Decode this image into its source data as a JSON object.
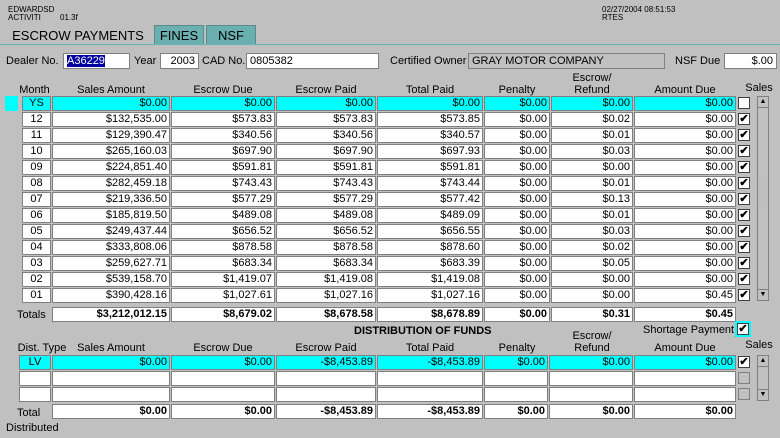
{
  "header": {
    "user": "EDWARDSD",
    "module": "ACTIVITI",
    "module_code": "01.3f",
    "datetime": "02/27/2004 08:51:53",
    "env": "RTES"
  },
  "tabs": [
    {
      "label": "ESCROW PAYMENTS",
      "active": true
    },
    {
      "label": "FINES",
      "active": false
    },
    {
      "label": "NSF",
      "active": false
    }
  ],
  "form": {
    "dealer_label": "Dealer No.",
    "dealer_value": "A36229",
    "year_label": "Year",
    "year_value": "2003",
    "cad_label": "CAD No.",
    "cad_value": "0805382",
    "owner_label": "Certified Owner",
    "owner_value": "GRAY MOTOR COMPANY",
    "nsf_label": "NSF Due",
    "nsf_value": "$.00"
  },
  "escrow_table": {
    "headers": {
      "month": "Month",
      "sales_amount": "Sales Amount",
      "escrow_due": "Escrow Due",
      "escrow_paid": "Escrow Paid",
      "total_paid": "Total Paid",
      "penalty": "Penalty",
      "escrow_refund_1": "Escrow/",
      "escrow_refund_2": "Refund",
      "amount_due": "Amount Due",
      "sales": "Sales"
    },
    "rows": [
      {
        "month": "YS",
        "sales": "$0.00",
        "due": "$0.00",
        "paid": "$0.00",
        "total": "$0.00",
        "penalty": "$0.00",
        "refund": "$0.00",
        "amount": "$0.00",
        "checked": "",
        "highlight": true
      },
      {
        "month": "12",
        "sales": "$132,535.00",
        "due": "$573.83",
        "paid": "$573.83",
        "total": "$573.85",
        "penalty": "$0.00",
        "refund": "$0.02",
        "amount": "$0.00",
        "checked": "✔",
        "highlight": false
      },
      {
        "month": "11",
        "sales": "$129,390.47",
        "due": "$340.56",
        "paid": "$340.56",
        "total": "$340.57",
        "penalty": "$0.00",
        "refund": "$0.01",
        "amount": "$0.00",
        "checked": "✔",
        "highlight": false
      },
      {
        "month": "10",
        "sales": "$265,160.03",
        "due": "$697.90",
        "paid": "$697.90",
        "total": "$697.93",
        "penalty": "$0.00",
        "refund": "$0.03",
        "amount": "$0.00",
        "checked": "✔",
        "highlight": false
      },
      {
        "month": "09",
        "sales": "$224,851.40",
        "due": "$591.81",
        "paid": "$591.81",
        "total": "$591.81",
        "penalty": "$0.00",
        "refund": "$0.00",
        "amount": "$0.00",
        "checked": "✔",
        "highlight": false
      },
      {
        "month": "08",
        "sales": "$282,459.18",
        "due": "$743.43",
        "paid": "$743.43",
        "total": "$743.44",
        "penalty": "$0.00",
        "refund": "$0.01",
        "amount": "$0.00",
        "checked": "✔",
        "highlight": false
      },
      {
        "month": "07",
        "sales": "$219,336.50",
        "due": "$577.29",
        "paid": "$577.29",
        "total": "$577.42",
        "penalty": "$0.00",
        "refund": "$0.13",
        "amount": "$0.00",
        "checked": "✔",
        "highlight": false
      },
      {
        "month": "06",
        "sales": "$185,819.50",
        "due": "$489.08",
        "paid": "$489.08",
        "total": "$489.09",
        "penalty": "$0.00",
        "refund": "$0.01",
        "amount": "$0.00",
        "checked": "✔",
        "highlight": false
      },
      {
        "month": "05",
        "sales": "$249,437.44",
        "due": "$656.52",
        "paid": "$656.52",
        "total": "$656.55",
        "penalty": "$0.00",
        "refund": "$0.03",
        "amount": "$0.00",
        "checked": "✔",
        "highlight": false
      },
      {
        "month": "04",
        "sales": "$333,808.06",
        "due": "$878.58",
        "paid": "$878.58",
        "total": "$878.60",
        "penalty": "$0.00",
        "refund": "$0.02",
        "amount": "$0.00",
        "checked": "✔",
        "highlight": false
      },
      {
        "month": "03",
        "sales": "$259,627.71",
        "due": "$683.34",
        "paid": "$683.34",
        "total": "$683.39",
        "penalty": "$0.00",
        "refund": "$0.05",
        "amount": "$0.00",
        "checked": "✔",
        "highlight": false
      },
      {
        "month": "02",
        "sales": "$539,158.70",
        "due": "$1,419.07",
        "paid": "$1,419.08",
        "total": "$1,419.08",
        "penalty": "$0.00",
        "refund": "$0.00",
        "amount": "$0.00",
        "checked": "✔",
        "highlight": false
      },
      {
        "month": "01",
        "sales": "$390,428.16",
        "due": "$1,027.61",
        "paid": "$1,027.16",
        "total": "$1,027.16",
        "penalty": "$0.00",
        "refund": "$0.00",
        "amount": "$0.45",
        "checked": "✔",
        "highlight": false
      }
    ],
    "totals": {
      "label": "Totals",
      "sales": "$3,212,012.15",
      "due": "$8,679.02",
      "paid": "$8,678.58",
      "total": "$8,678.89",
      "penalty": "$0.00",
      "refund": "$0.31",
      "amount": "$0.45"
    }
  },
  "distribution": {
    "title": "DISTRIBUTION OF FUNDS",
    "shortage_label": "Shortage Payment",
    "shortage_checked": "✔",
    "headers": {
      "dist_type": "Dist. Type",
      "sales_amount": "Sales Amount",
      "escrow_due": "Escrow Due",
      "escrow_paid": "Escrow Paid",
      "total_paid": "Total Paid",
      "penalty": "Penalty",
      "escrow_refund_1": "Escrow/",
      "escrow_refund_2": "Refund",
      "amount_due": "Amount Due",
      "sales": "Sales"
    },
    "rows": [
      {
        "type": "LV",
        "sales": "$0.00",
        "due": "$0.00",
        "paid": "-$8,453.89",
        "total": "-$8,453.89",
        "penalty": "$0.00",
        "refund": "$0.00",
        "amount": "$0.00",
        "checked": "✔",
        "highlight": true
      },
      {
        "type": "",
        "sales": "",
        "due": "",
        "paid": "",
        "total": "",
        "penalty": "",
        "refund": "",
        "amount": "",
        "checked": "",
        "highlight": false
      },
      {
        "type": "",
        "sales": "",
        "due": "",
        "paid": "",
        "total": "",
        "penalty": "",
        "refund": "",
        "amount": "",
        "checked": "",
        "highlight": false
      }
    ],
    "totals": {
      "label": "Total",
      "sales": "$0.00",
      "due": "$0.00",
      "paid": "-$8,453.89",
      "total": "-$8,453.89",
      "penalty": "$0.00",
      "refund": "$0.00",
      "amount": "$0.00"
    }
  },
  "footer": {
    "status": "Distributed"
  }
}
